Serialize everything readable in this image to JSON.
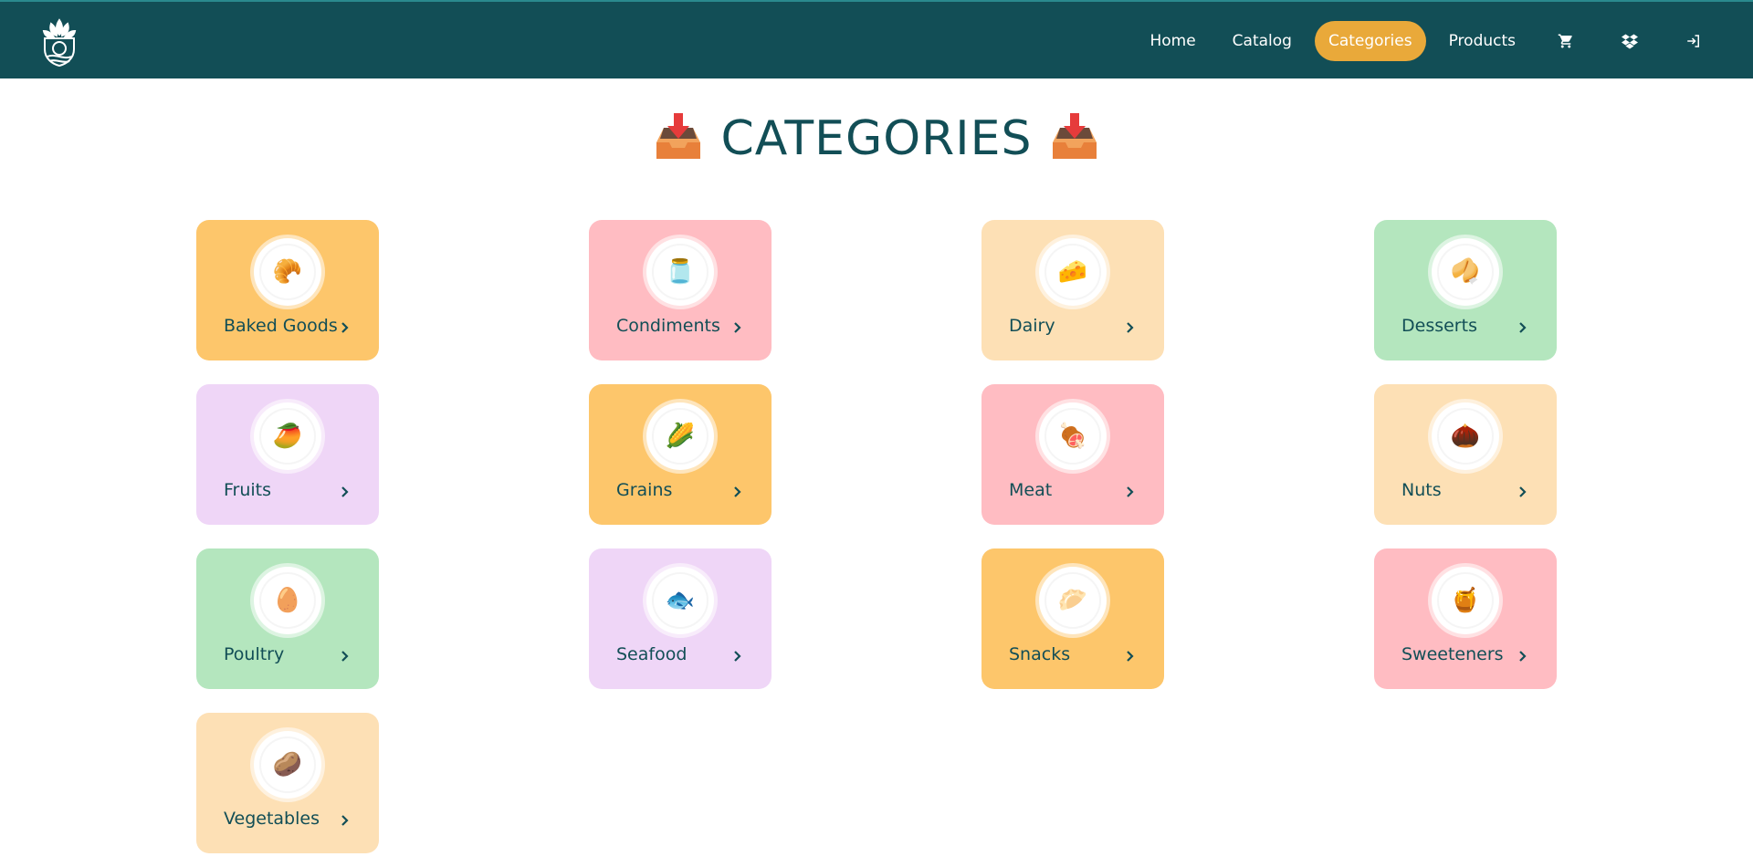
{
  "nav": {
    "items": [
      {
        "label": "Home",
        "active": false
      },
      {
        "label": "Catalog",
        "active": false
      },
      {
        "label": "Categories",
        "active": true
      },
      {
        "label": "Products",
        "active": false
      }
    ],
    "icons": [
      "cart-icon",
      "dropbox-icon",
      "logout-icon"
    ]
  },
  "page": {
    "title": "CATEGORIES",
    "title_icon": "inbox-tray-icon"
  },
  "colors": {
    "header_bg": "#124e56",
    "active_nav": "#e9a93a",
    "text": "#124e56"
  },
  "categories": [
    {
      "name": "Baked Goods",
      "icon": "croissant-icon",
      "glyph": "🥐",
      "color": "#fdc66b"
    },
    {
      "name": "Condiments",
      "icon": "jar-icon",
      "glyph": "🫙",
      "color": "#ffbcc2"
    },
    {
      "name": "Dairy",
      "icon": "cheese-icon",
      "glyph": "🧀",
      "color": "#fde0b5"
    },
    {
      "name": "Desserts",
      "icon": "fortune-cookie-icon",
      "glyph": "🥠",
      "color": "#b4e6be"
    },
    {
      "name": "Fruits",
      "icon": "mango-icon",
      "glyph": "🥭",
      "color": "#efd6f7"
    },
    {
      "name": "Grains",
      "icon": "corn-icon",
      "glyph": "🌽",
      "color": "#fdc66b"
    },
    {
      "name": "Meat",
      "icon": "meat-icon",
      "glyph": "🍖",
      "color": "#ffbcc2"
    },
    {
      "name": "Nuts",
      "icon": "chestnut-icon",
      "glyph": "🌰",
      "color": "#fde0b5"
    },
    {
      "name": "Poultry",
      "icon": "egg-icon",
      "glyph": "🥚",
      "color": "#b4e6be"
    },
    {
      "name": "Seafood",
      "icon": "fish-icon",
      "glyph": "🐟",
      "color": "#efd6f7"
    },
    {
      "name": "Snacks",
      "icon": "dumpling-icon",
      "glyph": "🥟",
      "color": "#fdc66b"
    },
    {
      "name": "Sweeteners",
      "icon": "honey-pot-icon",
      "glyph": "🍯",
      "color": "#ffbcc2"
    },
    {
      "name": "Vegetables",
      "icon": "potato-icon",
      "glyph": "🥔",
      "color": "#fde0b5"
    }
  ]
}
